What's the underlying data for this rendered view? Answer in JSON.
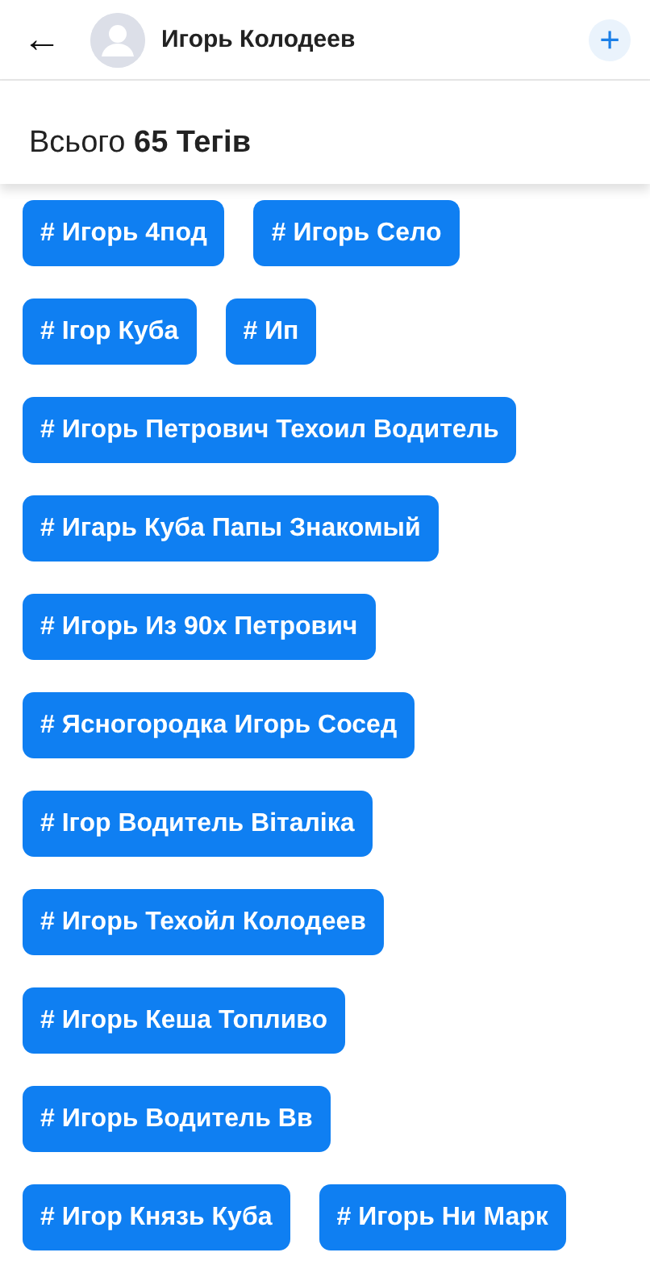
{
  "header": {
    "back_icon": "←",
    "title": "Игорь Колодеев",
    "add_icon": "+"
  },
  "total": "Всього **65 Тегів**",
  "tag_rows": [
    [
      "# Игорь 4под",
      "# Игорь Село"
    ],
    [
      "# Ігор Куба",
      "# Ип"
    ],
    [
      "# Игорь Петрович Техоил Водитель"
    ],
    [
      "# Игарь Куба Папы Знакомый"
    ],
    [
      "# Игорь Из 90х Петрович"
    ],
    [
      "# Ясногородка Игорь Сосед"
    ],
    [
      "# Ігор Водитель Віталіка"
    ],
    [
      "# Игорь Техойл Колодеев"
    ],
    [
      "# Игорь Кеша Топливо"
    ],
    [
      "# Игорь Водитель Вв"
    ],
    [
      "# Игор Князь Куба",
      "# Игорь Ни Марк"
    ]
  ]
}
